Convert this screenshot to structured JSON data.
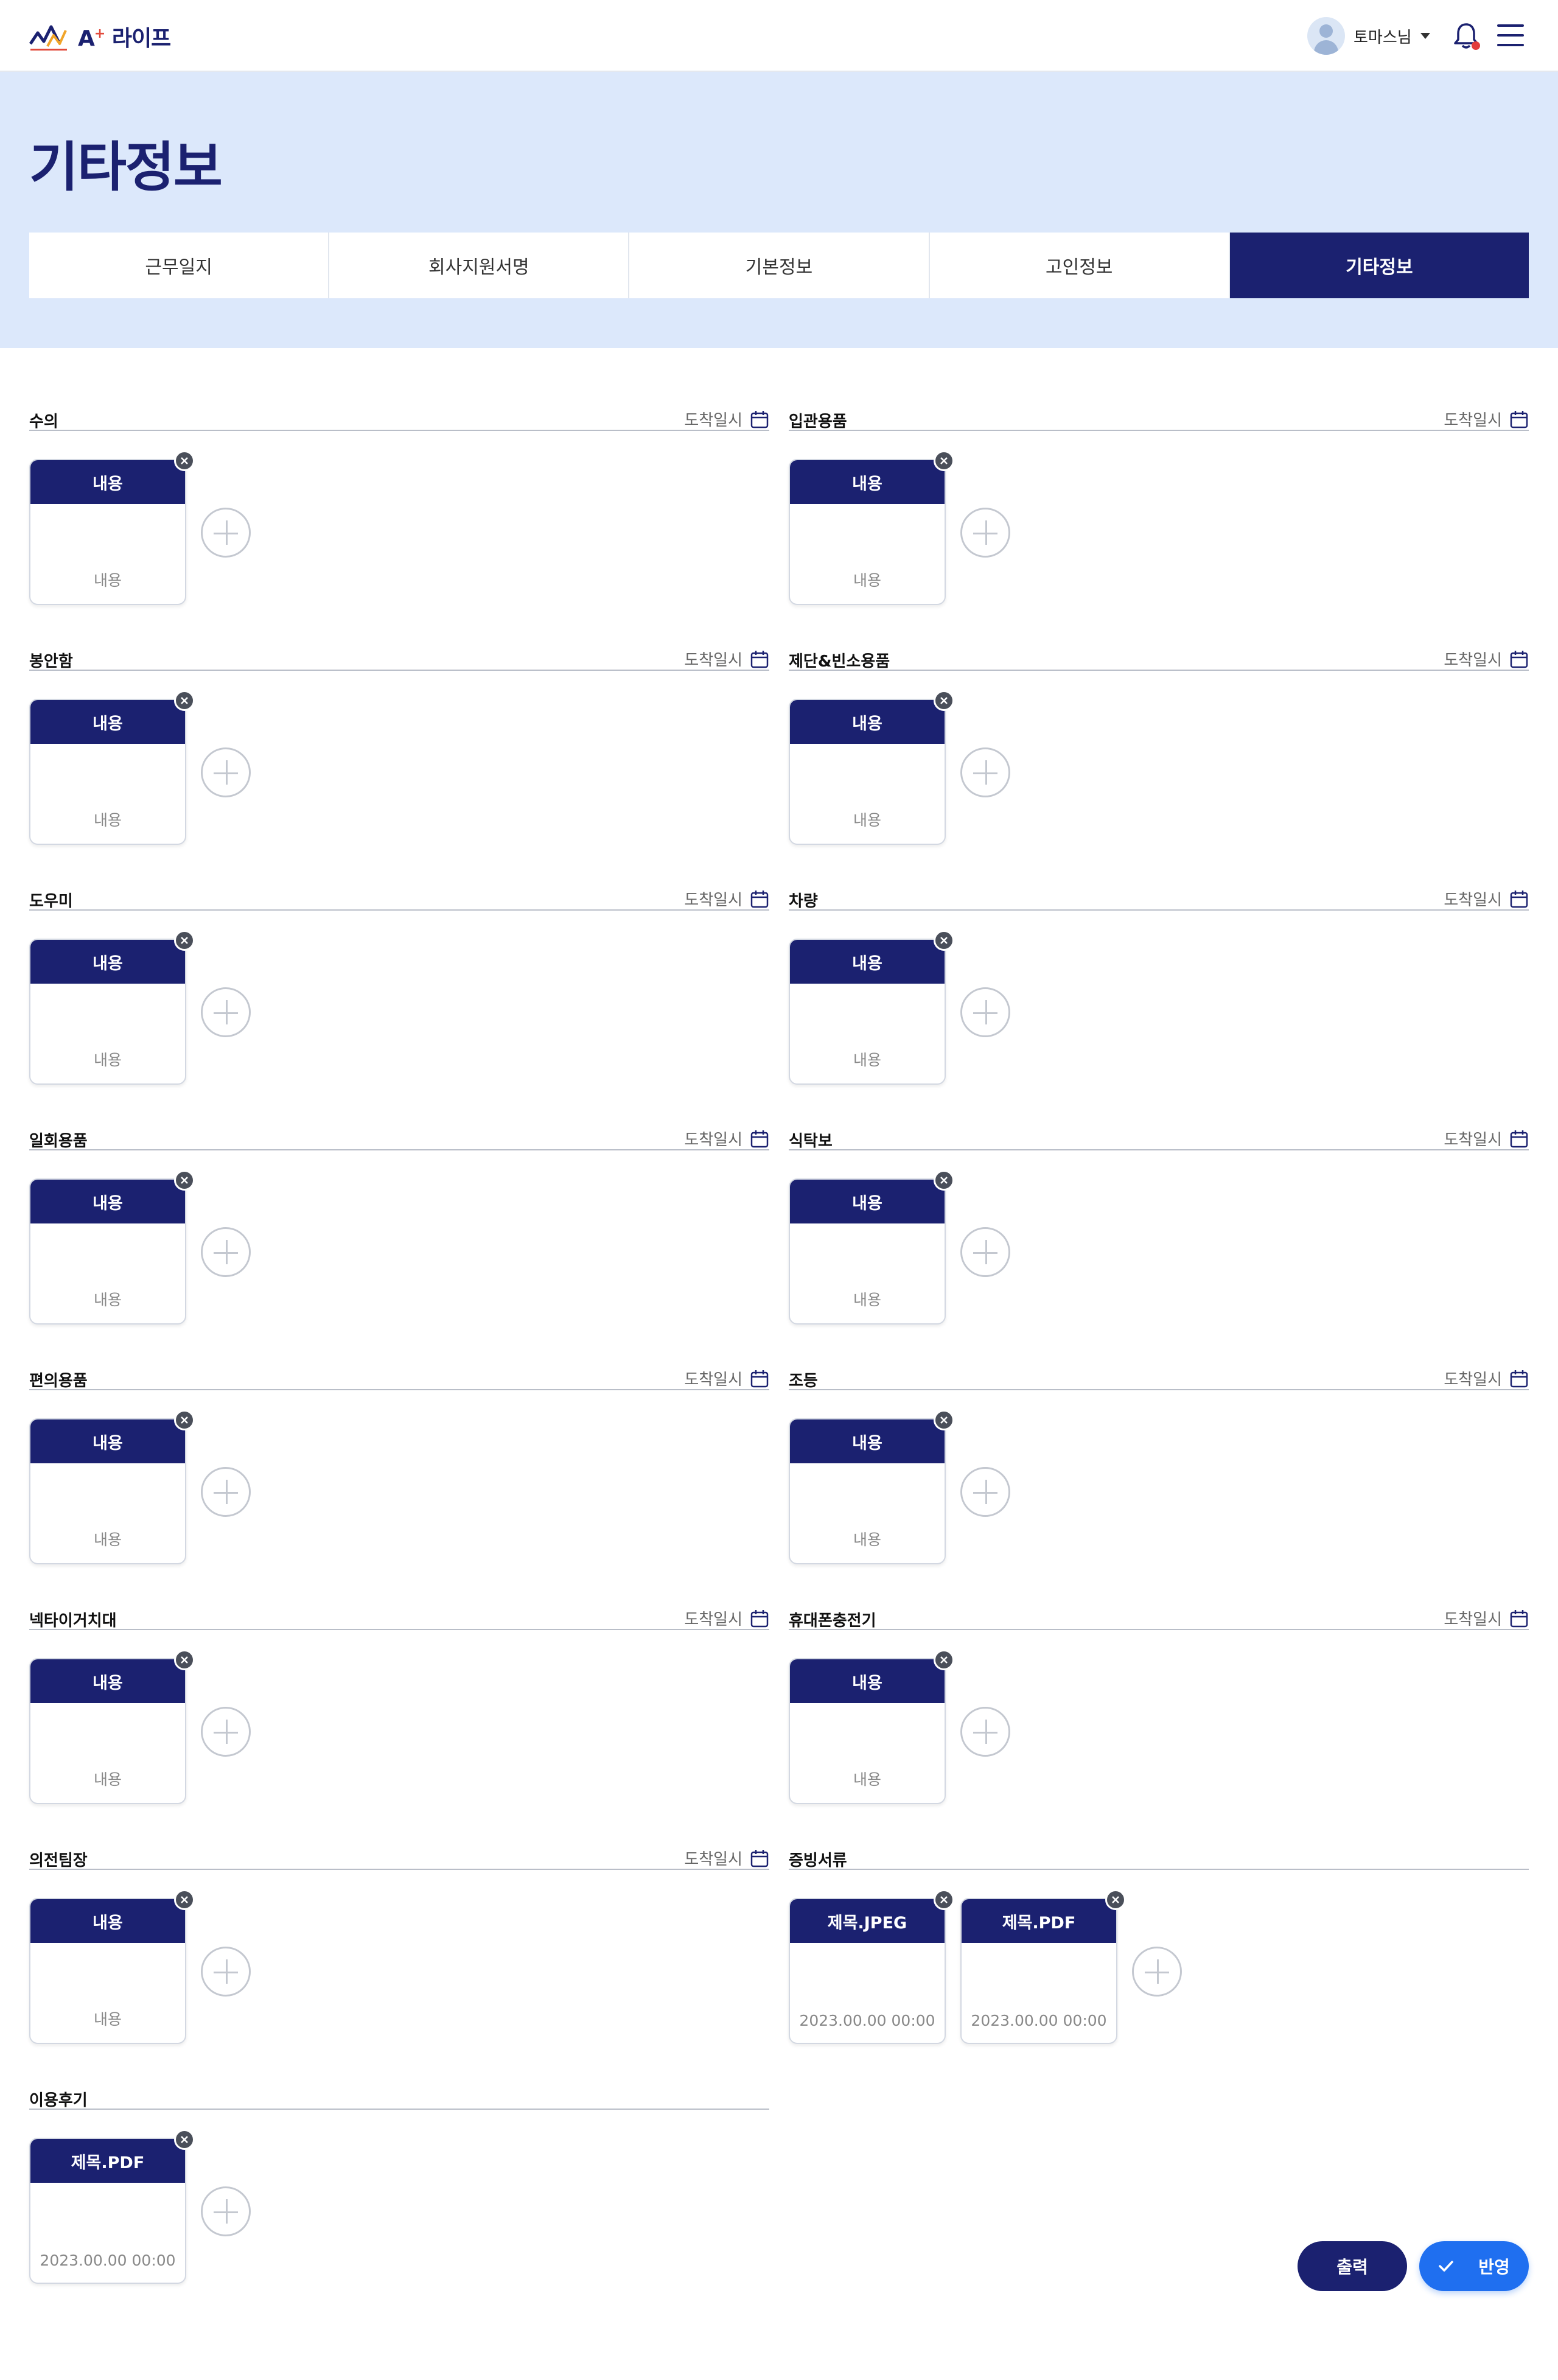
{
  "header": {
    "logo_text": "A",
    "logo_sup": "+",
    "logo_suffix": "라이프",
    "user_name": "토마스님"
  },
  "page": {
    "title": "기타정보"
  },
  "tabs": [
    {
      "label": "근무일지"
    },
    {
      "label": "회사지원서명"
    },
    {
      "label": "기본정보"
    },
    {
      "label": "고인정보"
    },
    {
      "label": "기타정보"
    }
  ],
  "date_label": "도착일시",
  "sections": {
    "s1": {
      "title": "수의",
      "card_title": "내용",
      "card_body": "내용"
    },
    "s2": {
      "title": "입관용품",
      "card_title": "내용",
      "card_body": "내용"
    },
    "s3": {
      "title": "봉안함",
      "card_title": "내용",
      "card_body": "내용"
    },
    "s4": {
      "title": "제단&빈소용품",
      "card_title": "내용",
      "card_body": "내용"
    },
    "s5": {
      "title": "도우미",
      "card_title": "내용",
      "card_body": "내용"
    },
    "s6": {
      "title": "차량",
      "card_title": "내용",
      "card_body": "내용"
    },
    "s7": {
      "title": "일회용품",
      "card_title": "내용",
      "card_body": "내용"
    },
    "s8": {
      "title": "식탁보",
      "card_title": "내용",
      "card_body": "내용"
    },
    "s9": {
      "title": "편의용품",
      "card_title": "내용",
      "card_body": "내용"
    },
    "s10": {
      "title": "조등",
      "card_title": "내용",
      "card_body": "내용"
    },
    "s11": {
      "title": "넥타이거치대",
      "card_title": "내용",
      "card_body": "내용"
    },
    "s12": {
      "title": "휴대폰충전기",
      "card_title": "내용",
      "card_body": "내용"
    },
    "s13": {
      "title": "의전팀장",
      "card_title": "내용",
      "card_body": "내용"
    },
    "s14": {
      "title": "증빙서류",
      "cards": [
        {
          "title": "제목.JPEG",
          "body": "2023.00.00 00:00"
        },
        {
          "title": "제목.PDF",
          "body": "2023.00.00 00:00"
        }
      ]
    },
    "s15": {
      "title": "이용후기",
      "card_title": "제목.PDF",
      "card_body": "2023.00.00 00:00"
    }
  },
  "actions": {
    "print_label": "출력",
    "apply_label": "반영"
  },
  "colors": {
    "brand_navy": "#1b2170",
    "hero_bg": "#dce8fb",
    "apply_blue": "#1f6ff0"
  }
}
